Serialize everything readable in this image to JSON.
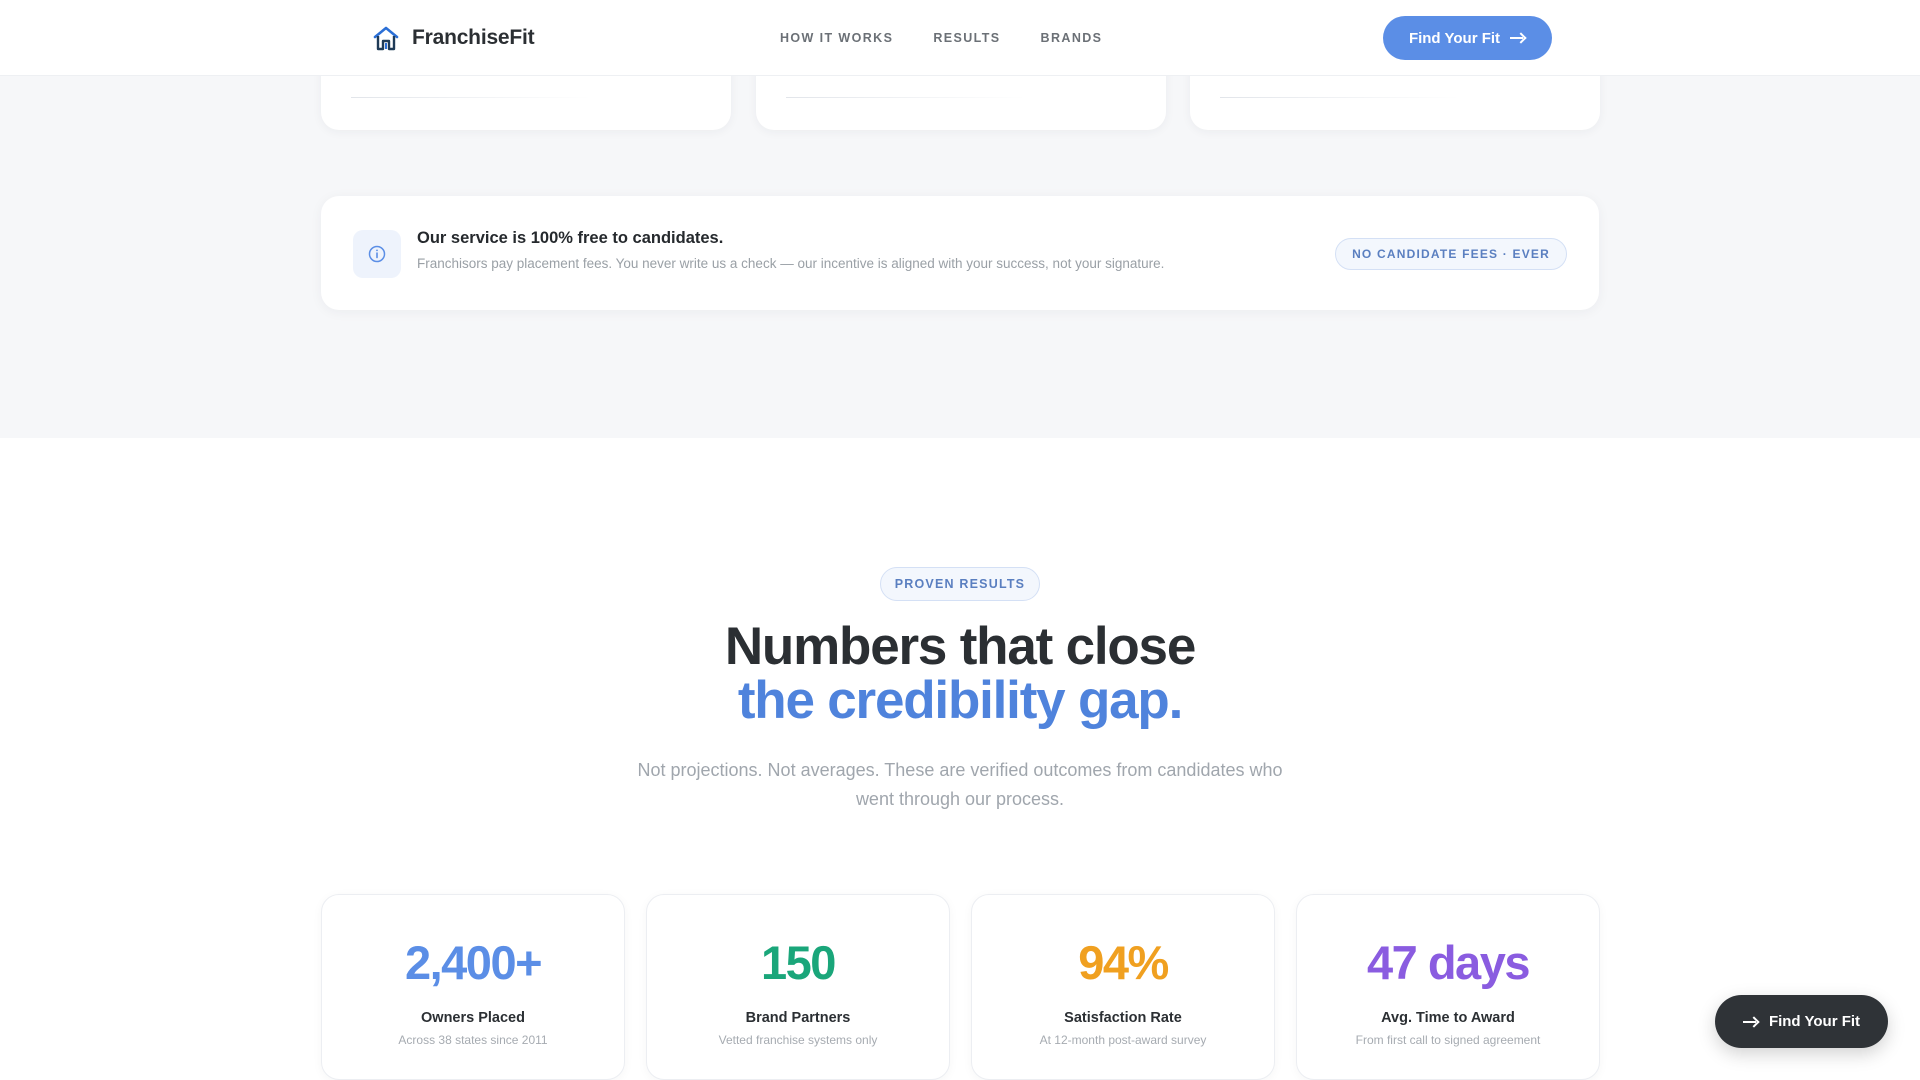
{
  "brand": {
    "name": "FranchiseFit",
    "icon": "house-icon"
  },
  "nav": {
    "items": [
      {
        "label": "HOW IT WORKS"
      },
      {
        "label": "RESULTS"
      },
      {
        "label": "BRANDS"
      }
    ],
    "cta_label": "Find Your Fit"
  },
  "notice": {
    "icon": "info-icon",
    "title": "Our service is 100% free to candidates.",
    "description": "Franchisors pay placement fees. You never write us a check — our incentive is aligned with your success, not your signature.",
    "badge": "NO CANDIDATE FEES · EVER"
  },
  "results": {
    "eyebrow": "PROVEN RESULTS",
    "headline_line1": "Numbers that close",
    "headline_line2": "the credibility gap.",
    "subcopy": "Not projections. Not averages. These are verified outcomes from candidates who went through our process.",
    "stats": [
      {
        "value": "2,400+",
        "label": "Owners Placed",
        "sub": "Across 38 states since 2011",
        "color": "#5b8ee6"
      },
      {
        "value": "150",
        "label": "Brand Partners",
        "sub": "Vetted franchise systems only",
        "color": "#1aa67a"
      },
      {
        "value": "94%",
        "label": "Satisfaction Rate",
        "sub": "At 12-month post-award survey",
        "color": "#f0a020"
      },
      {
        "value": "47 days",
        "label": "Avg. Time to Award",
        "sub": "From first call to signed agreement",
        "color": "#8a5ce0"
      }
    ]
  },
  "floating_cta": {
    "label": "Find Your Fit"
  },
  "colors": {
    "accent": "#5b8ee6",
    "headline_accent": "#4f83dc",
    "dark": "#2f3337"
  }
}
